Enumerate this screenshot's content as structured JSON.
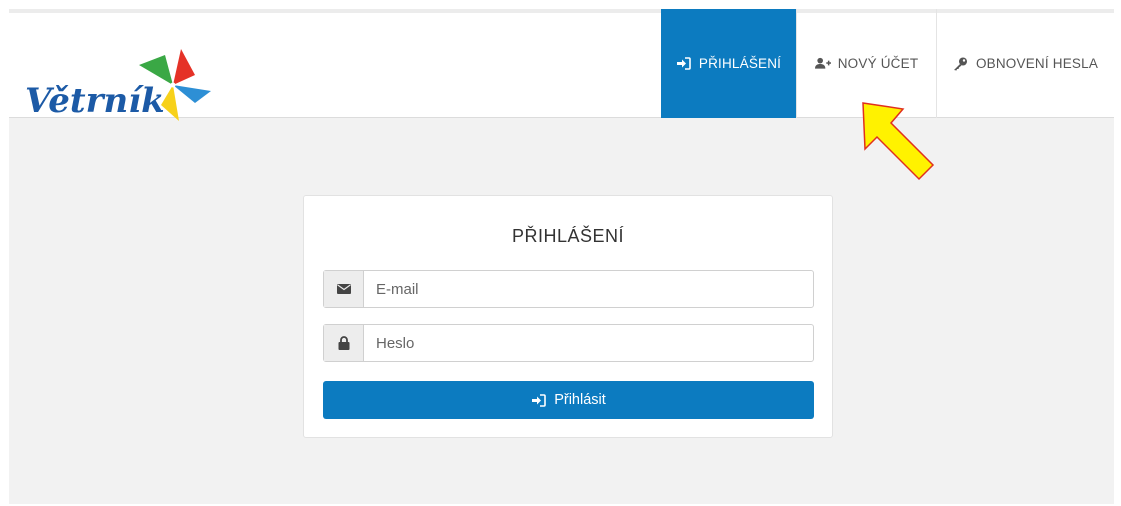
{
  "brand": {
    "name": "Větrník"
  },
  "nav": {
    "login_label": "PŘIHLÁŠENÍ",
    "new_account_label": "NOVÝ ÚČET",
    "reset_password_label": "OBNOVENÍ HESLA"
  },
  "login_form": {
    "title": "PŘIHLÁŠENÍ",
    "email_placeholder": "E-mail",
    "password_placeholder": "Heslo",
    "submit_label": "Přihlásit"
  },
  "colors": {
    "accent": "#0c7bc0",
    "brand_text": "#1c5aa6",
    "annotation_arrow": "#fff200"
  }
}
